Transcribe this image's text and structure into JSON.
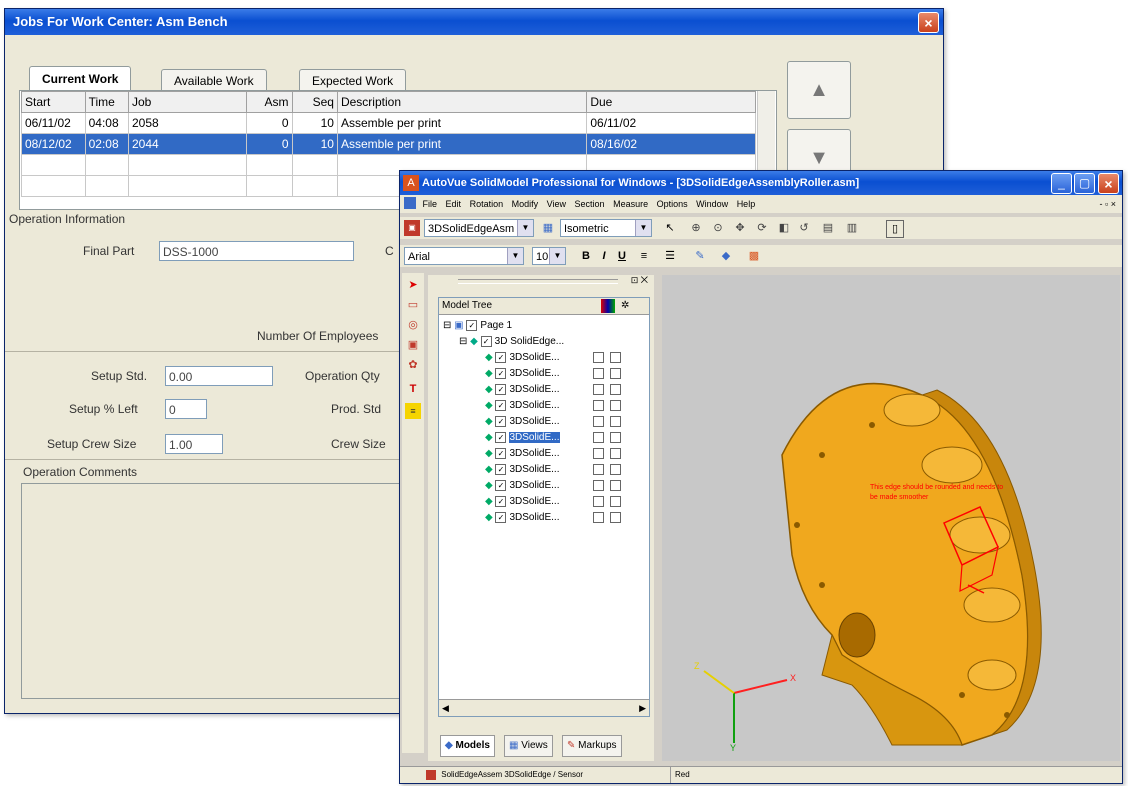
{
  "jobs_window": {
    "title": "Jobs For Work Center: Asm Bench",
    "close_glyph": "×",
    "tabs": [
      "Current Work",
      "Available Work",
      "Expected Work"
    ],
    "columns": [
      "Start",
      "Time",
      "Job",
      "Asm",
      "Seq",
      "Description",
      "Due"
    ],
    "rows": [
      [
        "06/11/02",
        "04:08",
        "2058",
        "0",
        "10",
        "Assemble per print",
        "06/11/02"
      ],
      [
        "08/12/02",
        "02:08",
        "2044",
        "0",
        "10",
        "Assemble per print",
        "08/16/02"
      ]
    ],
    "selected_row": 1,
    "operation_info_label": "Operation Information",
    "final_part_label": "Final Part",
    "final_part_value": "DSS-1000",
    "truncated_c_label": "C",
    "num_employees_label": "Number Of Employees",
    "setup_std_label": "Setup Std.",
    "setup_std_value": "0.00",
    "setup_pct_left_label": "Setup % Left",
    "setup_pct_left_value": "0",
    "setup_crew_size_label": "Setup Crew Size",
    "setup_crew_size_value": "1.00",
    "operation_qty_label": "Operation Qty",
    "prod_std_label": "Prod. Std",
    "crew_size_label": "Crew Size",
    "operation_comments_label": "Operation Comments",
    "up_glyph": "▲",
    "down_glyph": "▼"
  },
  "autovue_window": {
    "title": "AutoVue SolidModel Professional for Windows - [3DSolidEdgeAssemblyRoller.asm]",
    "title_buttons": [
      "_",
      "▢",
      "×"
    ],
    "menu": [
      "File",
      "Edit",
      "Rotation",
      "Modify",
      "View",
      "Section",
      "Measure",
      "Options",
      "Window",
      "Help"
    ],
    "mdi_controls": "- ▫ ×",
    "toolbar1": {
      "combo1_value": "3DSolidEdgeAsm",
      "combo2_value": "Isometric"
    },
    "toolbar2": {
      "font_value": "Arial",
      "size_value": "10",
      "bold": "B",
      "italic": "I",
      "underline": "U"
    },
    "model_tree": {
      "header": "Model Tree",
      "root": "Page 1",
      "assembly": "3D SolidEdge...",
      "parts": [
        "3DSolidE...",
        "3DSolidE...",
        "3DSolidE...",
        "3DSolidE...",
        "3DSolidE...",
        "3DSolidE...",
        "3DSolidE...",
        "3DSolidE...",
        "3DSolidE...",
        "3DSolidE...",
        "3DSolidE..."
      ],
      "selected_part_index": 5
    },
    "bottom_tabs": [
      "Models",
      "Views",
      "Markups"
    ],
    "markup_note": "This edge should be rounded and needs to be made smoother",
    "axis_labels": {
      "x": "X",
      "y": "Y",
      "z": "Z"
    },
    "status": {
      "left": "SolidEdgeAssem 3DSolidEdge / Sensor",
      "right": "Red"
    },
    "colors": {
      "viewport_bg": "#c8c8c8",
      "model": "#f0a81e",
      "markup": "#ff0000"
    }
  }
}
